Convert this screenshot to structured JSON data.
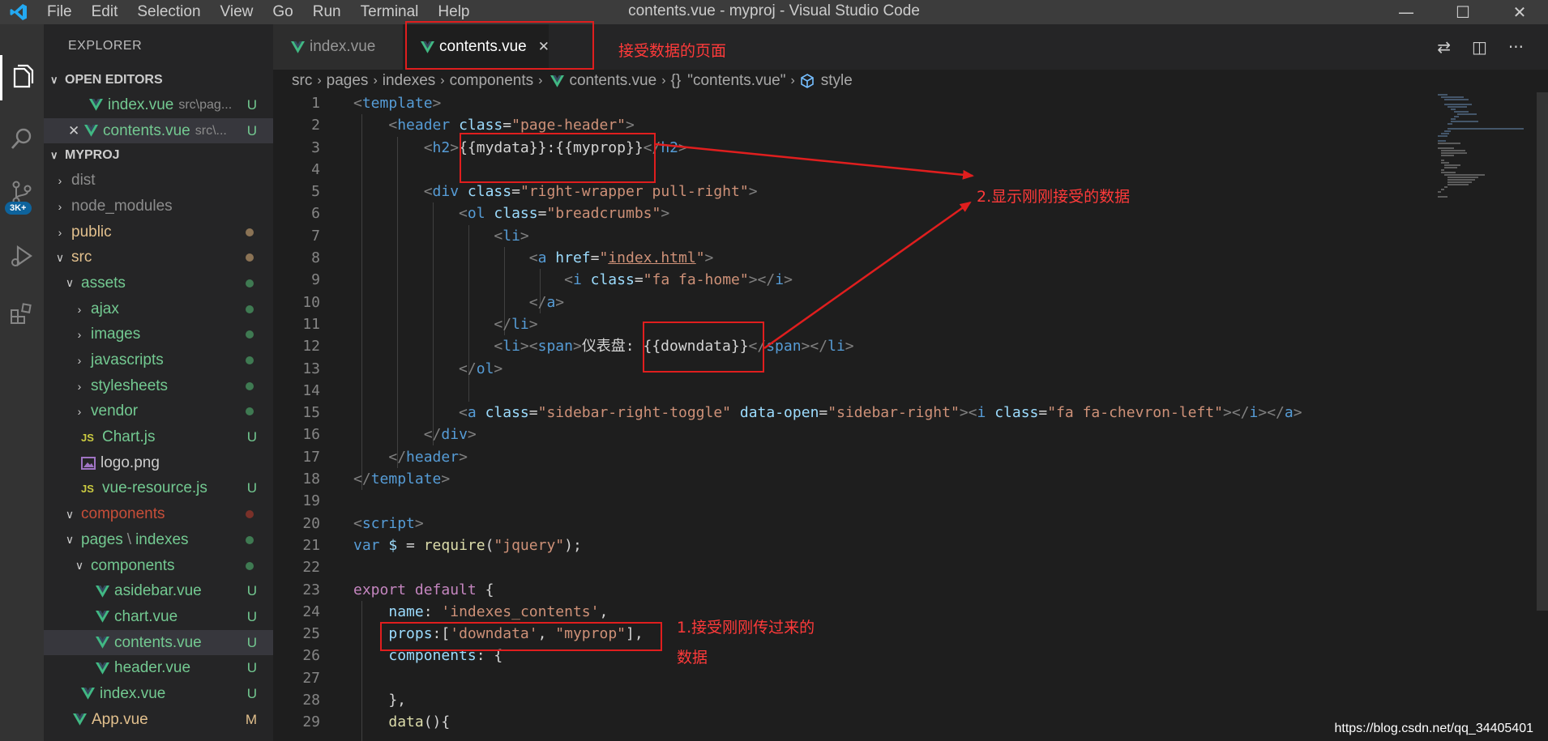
{
  "window": {
    "title": "contents.vue - myproj - Visual Studio Code",
    "menu": [
      "File",
      "Edit",
      "Selection",
      "View",
      "Go",
      "Run",
      "Terminal",
      "Help"
    ]
  },
  "activity": {
    "badge": "3K+"
  },
  "explorer": {
    "title": "EXPLORER",
    "open_editors": {
      "heading": "OPEN EDITORS",
      "items": [
        {
          "name": "index.vue",
          "path": "src\\pag...",
          "status": "U"
        },
        {
          "name": "contents.vue",
          "path": "src\\...",
          "status": "U"
        }
      ]
    },
    "project": {
      "heading": "MYPROJ",
      "rows": [
        {
          "label": "dist"
        },
        {
          "label": "node_modules"
        },
        {
          "label": "public"
        },
        {
          "label": "src"
        },
        {
          "label": "assets"
        },
        {
          "label": "ajax"
        },
        {
          "label": "images"
        },
        {
          "label": "javascripts"
        },
        {
          "label": "stylesheets"
        },
        {
          "label": "vendor"
        },
        {
          "label": "Chart.js",
          "status": "U",
          "icon": "js-icon"
        },
        {
          "label": "logo.png",
          "icon": "image-icon"
        },
        {
          "label": "vue-resource.js",
          "status": "U",
          "icon": "js-icon"
        },
        {
          "label": "components"
        },
        {
          "label": "pages",
          "label2": "indexes"
        },
        {
          "label": "components"
        },
        {
          "label": "asidebar.vue",
          "status": "U"
        },
        {
          "label": "chart.vue",
          "status": "U"
        },
        {
          "label": "contents.vue",
          "status": "U"
        },
        {
          "label": "header.vue",
          "status": "U"
        },
        {
          "label": "index.vue",
          "status": "U"
        },
        {
          "label": "App.vue",
          "status": "M"
        }
      ]
    }
  },
  "tabs": [
    {
      "label": "index.vue"
    },
    {
      "label": "contents.vue"
    }
  ],
  "breadcrumb": [
    "src",
    "pages",
    "indexes",
    "components",
    "contents.vue",
    "{}",
    "\"contents.vue\"",
    "style"
  ],
  "code": {
    "line_numbers": [
      "1",
      "2",
      "3",
      "4",
      "5",
      "6",
      "7",
      "8",
      "9",
      "10",
      "11",
      "12",
      "13",
      "14",
      "15",
      "16",
      "17",
      "18",
      "19",
      "20",
      "21",
      "22",
      "23",
      "24",
      "25",
      "26",
      "27",
      "28",
      "29"
    ],
    "lines": [
      "<template>",
      "    <header class=\"page-header\">",
      "        <h2>{{mydata}}:{{myprop}}</h2>",
      "",
      "        <div class=\"right-wrapper pull-right\">",
      "            <ol class=\"breadcrumbs\">",
      "                <li>",
      "                    <a href=\"index.html\">",
      "                        <i class=\"fa fa-home\"></i>",
      "                    </a>",
      "                </li>",
      "                <li><span>仪表盘: {{downdata}}</span></li>",
      "            </ol>",
      "",
      "            <a class=\"sidebar-right-toggle\" data-open=\"sidebar-right\"><i class=\"fa fa-chevron-left\"></i></a>",
      "        </div>",
      "    </header>",
      "</template>",
      "",
      "<script>",
      "var $ = require(\"jquery\");",
      "",
      "export default {",
      "    name: 'indexes_contents',",
      "    props:['downdata', \"myprop\"],",
      "    components: {",
      "",
      "    },",
      "    data(){"
    ]
  },
  "annotations": {
    "tab_note": "接受数据的页面",
    "display_note": "2.显示刚刚接受的数据",
    "props_note_line1": "1.接受刚刚传过来的",
    "props_note_line2": "数据"
  },
  "watermark": "https://blog.csdn.net/qq_34405401",
  "colors": {
    "accent_annotation": "#e01e1e",
    "vue_green": "#41b883",
    "untracked_status": "#73c991",
    "modified_status": "#e2c08d"
  }
}
